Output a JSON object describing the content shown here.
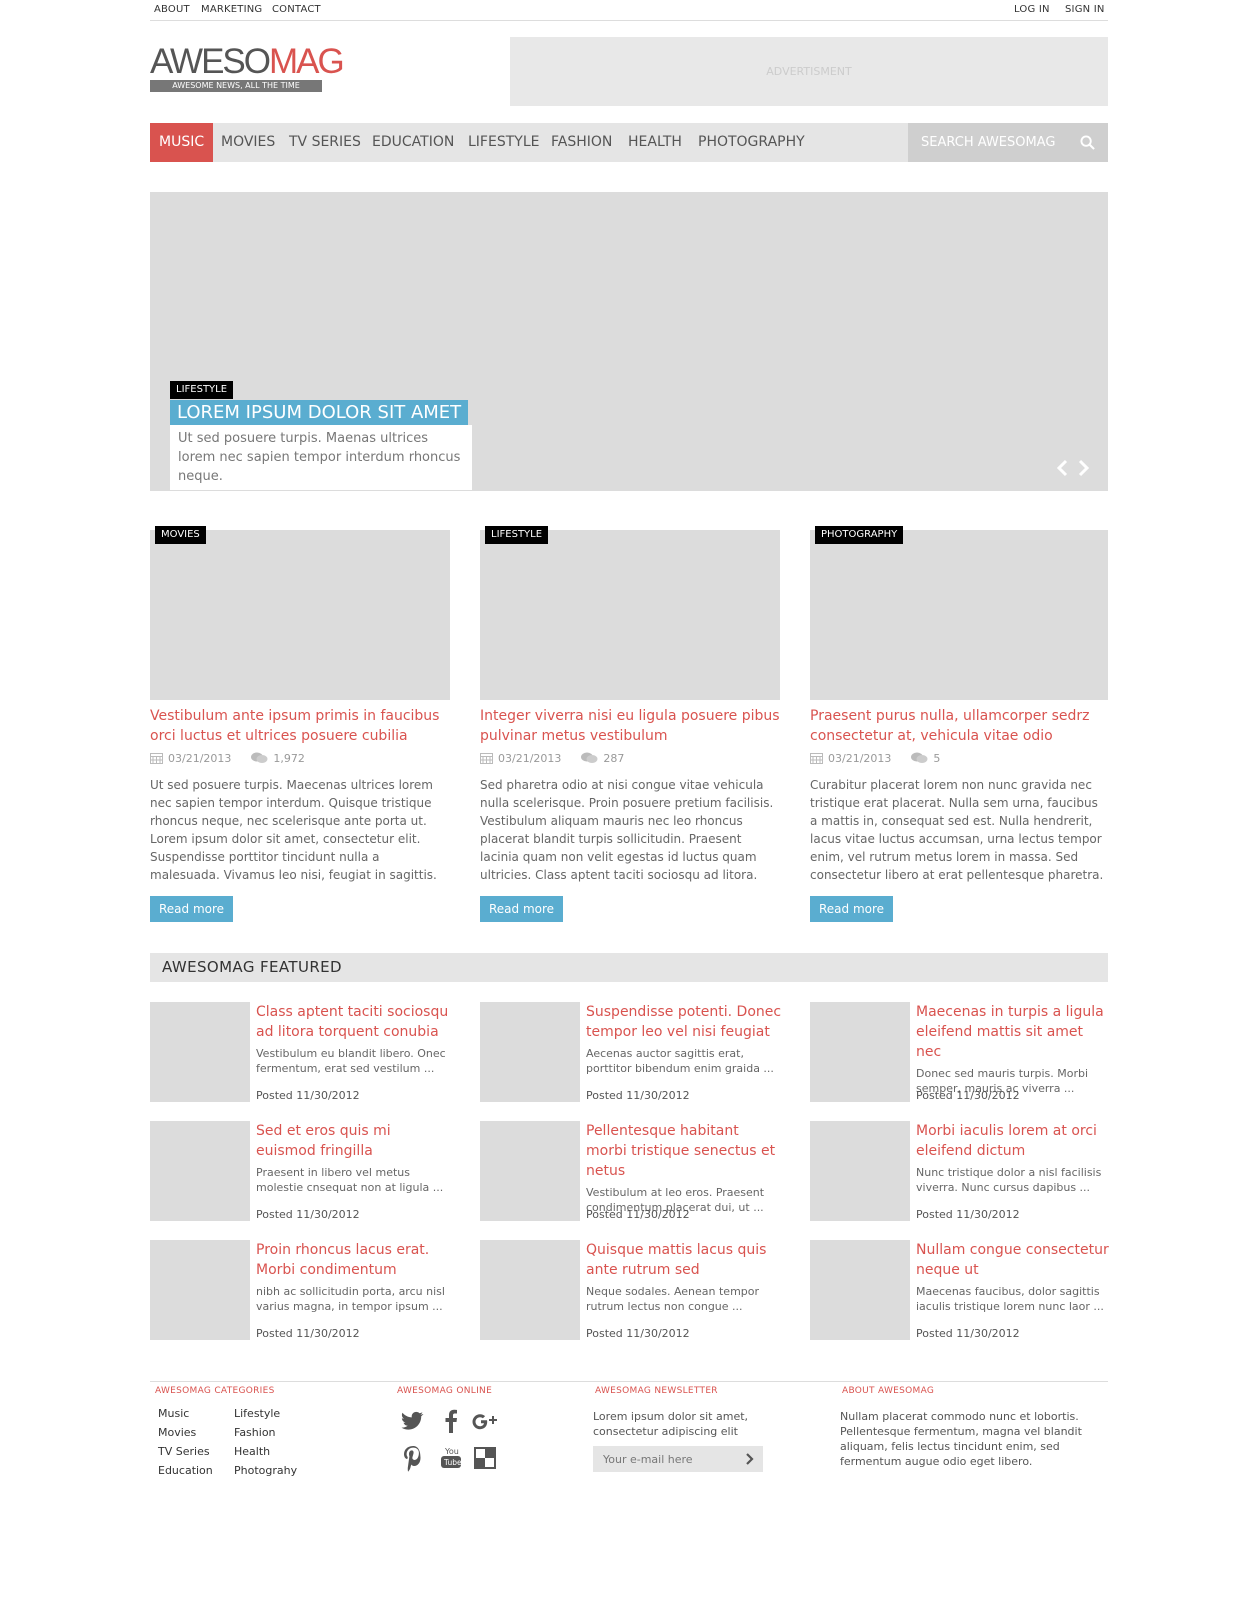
{
  "topbar": {
    "left_links": [
      "ABOUT",
      "MARKETING",
      "CONTACT"
    ],
    "right_links": [
      "LOG IN",
      "SIGN IN"
    ]
  },
  "logo": {
    "name_main": "AWESO",
    "name_accent": "MAG",
    "tagline": "AWESOME NEWS, ALL THE TIME"
  },
  "ad": {
    "label": "ADVERTISMENT"
  },
  "nav": {
    "items": [
      "MUSIC",
      "MOVIES",
      "TV SERIES",
      "EDUCATION",
      "LIFESTYLE",
      "FASHION",
      "HEALTH",
      "PHOTOGRAPHY"
    ],
    "active": "MUSIC",
    "search_placeholder": "SEARCH AWESOMAG"
  },
  "slider": {
    "category": "LIFESTYLE",
    "title": "LOREM IPSUM DOLOR SIT AMET",
    "description": "Ut sed posuere turpis. Maenas ultrices lorem nec sapien tempor interdum rhoncus neque."
  },
  "articles": [
    {
      "category": "MOVIES",
      "title": "Vestibulum ante ipsum primis in faucibus orci luctus et ultrices posuere cubilia",
      "date": "03/21/2013",
      "comments": "1,972",
      "excerpt": "Ut sed posuere turpis. Maecenas ultrices lorem nec sapien tempor interdum. Quisque tristique rhoncus neque, nec scelerisque ante porta ut. Lorem ipsum dolor sit amet, consectetur  elit. Suspendisse porttitor tincidunt nulla a malesuada. Vivamus leo nisi, feugiat in sagittis.",
      "button": "Read more"
    },
    {
      "category": "LIFESTYLE",
      "title": "Integer viverra nisi eu ligula posuere pibus pulvinar metus vestibulum",
      "date": "03/21/2013",
      "comments": "287",
      "excerpt": "Sed pharetra odio at nisi congue vitae vehicula nulla scelerisque. Proin posuere pretium facilisis. Vestibulum aliquam mauris nec leo rhoncus placerat blandit turpis sollicitudin. Praesent lacinia quam non velit egestas id luctus quam ultricies. Class aptent taciti sociosqu ad litora.",
      "button": "Read more"
    },
    {
      "category": "PHOTOGRAPHY",
      "title": "Praesent purus nulla, ullamcorper sedrz consectetur at, vehicula vitae odio",
      "date": "03/21/2013",
      "comments": "5",
      "excerpt": "Curabitur placerat lorem non nunc gravida nec tristique erat placerat. Nulla sem urna, faucibus a mattis in, consequat sed est. Nulla hendrerit, lacus vitae luctus accumsan, urna lectus tempor enim, vel rutrum metus lorem in massa. Sed consectetur libero at erat pellentesque pharetra.",
      "button": "Read more"
    }
  ],
  "featured": {
    "heading": "AWESOMAG FEATURED",
    "items": [
      {
        "title": "Class aptent taciti sociosqu ad litora torquent conubia",
        "excerpt": "Vestibulum eu blandit libero. Onec fermentum, erat sed vestilum ...",
        "posted": "Posted 11/30/2012"
      },
      {
        "title": "Suspendisse potenti. Donec tempor leo vel nisi feugiat",
        "excerpt": "Aecenas auctor sagittis erat, porttitor bibendum enim graida ...",
        "posted": "Posted 11/30/2012"
      },
      {
        "title": "Maecenas in turpis a ligula eleifend mattis sit amet nec",
        "excerpt": "Donec sed mauris turpis. Morbi semper, mauris ac viverra ...",
        "posted": "Posted 11/30/2012"
      },
      {
        "title": "Sed et eros quis mi euismod fringilla",
        "excerpt": "Praesent in libero vel metus molestie cnsequat non at ligula ...",
        "posted": "Posted 11/30/2012"
      },
      {
        "title": "Pellentesque habitant morbi tristique senectus et netus",
        "excerpt": "Vestibulum at leo eros. Praesent condimentum placerat dui, ut ...",
        "posted": "Posted 11/30/2012"
      },
      {
        "title": "Morbi iaculis lorem at orci eleifend dictum",
        "excerpt": "Nunc tristique dolor a nisl facilisis viverra. Nunc cursus dapibus ...",
        "posted": "Posted 11/30/2012"
      },
      {
        "title": "Proin rhoncus lacus erat. Morbi condimentum",
        "excerpt": "nibh ac sollicitudin porta, arcu nisl varius magna, in tempor ipsum ...",
        "posted": "Posted 11/30/2012"
      },
      {
        "title": "Quisque mattis lacus quis ante rutrum sed",
        "excerpt": "Neque sodales. Aenean tempor rutrum lectus non congue ...",
        "posted": "Posted 11/30/2012"
      },
      {
        "title": "Nullam congue consectetur neque ut",
        "excerpt": "Maecenas faucibus, dolor sagittis iaculis tristique lorem nunc laor ...",
        "posted": "Posted 11/30/2012"
      }
    ]
  },
  "footer": {
    "categories": {
      "heading": "AWESOMAG CATEGORIES",
      "col1": [
        "Music",
        "Movies",
        "TV Series",
        "Education"
      ],
      "col2": [
        "Lifestyle",
        "Fashion",
        "Health",
        "Photograhy"
      ]
    },
    "online": {
      "heading": "AWESOMAG ONLINE",
      "icons": [
        "twitter-icon",
        "facebook-icon",
        "google-plus-icon",
        "pinterest-icon",
        "youtube-icon",
        "delicious-icon"
      ]
    },
    "newsletter": {
      "heading": "AWESOMAG NEWSLETTER",
      "text": "Lorem ipsum dolor sit amet, consectetur adipiscing elit",
      "placeholder": "Your e-mail here"
    },
    "about": {
      "heading": "ABOUT AWESOMAG",
      "text": "Nullam placerat commodo nunc et lobortis. Pellentesque fermentum, magna vel blandit aliquam, felis lectus tincidunt enim, sed fermentum augue odio eget libero."
    }
  },
  "colors": {
    "accent": "#d9534f",
    "blue": "#5aadd0",
    "placeholder_gray": "#dcdcdc",
    "bar_gray": "#e5e5e5"
  }
}
